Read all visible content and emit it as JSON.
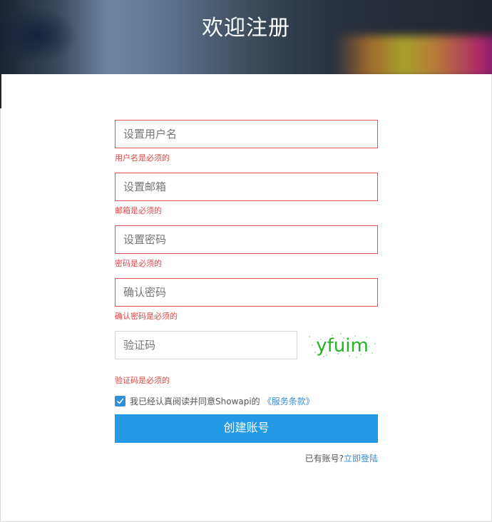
{
  "header": {
    "title": "欢迎注册"
  },
  "form": {
    "username": {
      "placeholder": "设置用户名",
      "error": "用户名是必须的"
    },
    "email": {
      "placeholder": "设置邮箱",
      "error": "邮箱是必须的"
    },
    "password": {
      "placeholder": "设置密码",
      "error": "密码是必须的"
    },
    "confirm": {
      "placeholder": "确认密码",
      "error": "确认密码是必须的"
    },
    "captcha": {
      "placeholder": "验证码",
      "error": "验证码是必须的",
      "image_text": "yfuim"
    },
    "agreement": {
      "checked": true,
      "text": "我已经认真阅读并同意Showapi的",
      "terms_link": "《服务条款》"
    },
    "submit_label": "创建账号",
    "login_prompt": "已有账号?",
    "login_link": "立即登陆"
  },
  "colors": {
    "error": "#e04848",
    "primary_button": "#2499e6",
    "link": "#3a8ed6",
    "captcha_text": "#22b422"
  }
}
